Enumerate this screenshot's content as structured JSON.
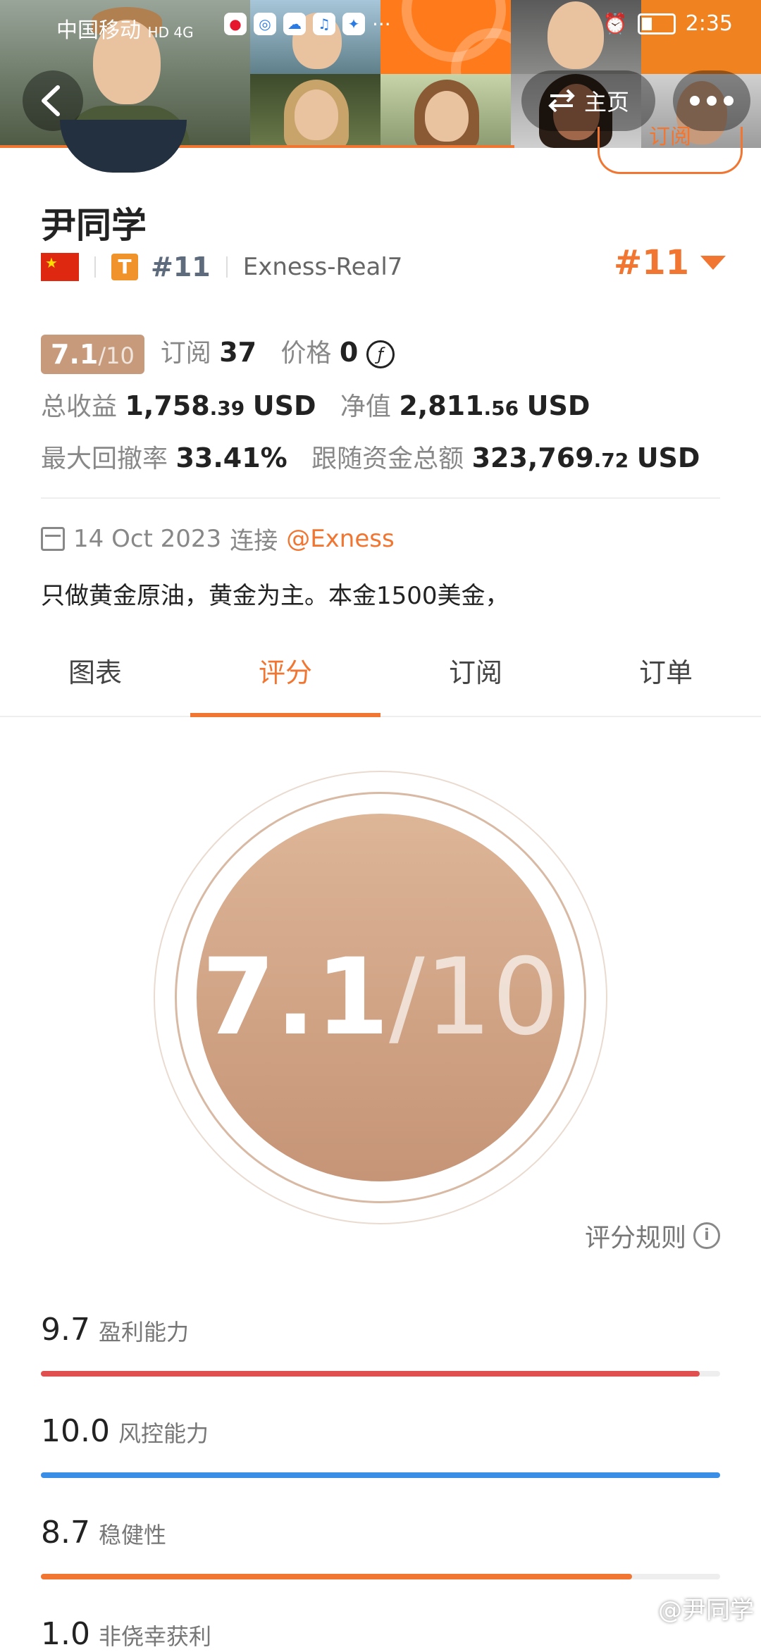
{
  "status_bar": {
    "carrier": "中国移动",
    "network": "HD 4G",
    "time": "2:35"
  },
  "nav": {
    "home_label": "主页",
    "follow_label": "订阅"
  },
  "profile": {
    "name": "尹同学",
    "badge": "T",
    "rank": "#11",
    "server": "Exness-Real7",
    "rank_right": "#11"
  },
  "stats": {
    "score_main": "7.1",
    "score_denom": "/10",
    "subscribe_label": "订阅",
    "subscribe_count": "37",
    "price_label": "价格",
    "price_value": "0",
    "price_icon": "ƒ",
    "profit_label": "总收益",
    "profit_value": "1,758",
    "profit_decimal": ".39",
    "profit_unit": "USD",
    "equity_label": "净值",
    "equity_value": "2,811",
    "equity_decimal": ".56",
    "equity_unit": "USD",
    "drawdown_label": "最大回撤率",
    "drawdown_value": "33.41%",
    "follow_funds_label": "跟随资金总额",
    "follow_funds_value": "323,769",
    "follow_funds_decimal": ".72",
    "follow_funds_unit": "USD"
  },
  "info": {
    "date": "14 Oct 2023",
    "connect_label": "连接",
    "broker": "@Exness",
    "description": "只做黄金原油，黄金为主。本金1500美金，"
  },
  "tabs": [
    {
      "label": "图表"
    },
    {
      "label": "评分"
    },
    {
      "label": "订阅"
    },
    {
      "label": "订单"
    }
  ],
  "score": {
    "value": "7.1",
    "denom": "/10",
    "rules_label": "评分规则"
  },
  "metrics": [
    {
      "value": "9.7",
      "label": "盈利能力",
      "fraction": 0.97,
      "color": "#e05050"
    },
    {
      "value": "10.0",
      "label": "风控能力",
      "fraction": 1.0,
      "color": "#3a8ee6"
    },
    {
      "value": "8.7",
      "label": "稳健性",
      "fraction": 0.87,
      "color": "#f07632"
    },
    {
      "value": "1.0",
      "label": "非侥幸获利",
      "fraction": 0.1,
      "color": "#f0a020"
    }
  ],
  "colors": {
    "accent": "#f07632",
    "score_bronze": "#c69476"
  },
  "watermark": "@尹同学"
}
